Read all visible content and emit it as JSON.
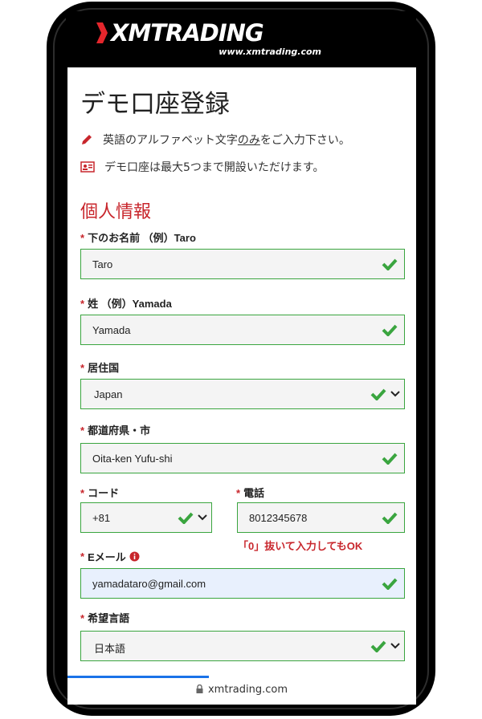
{
  "logo": {
    "brand": "XMTRADING",
    "url": "www.xmtrading.com"
  },
  "page": {
    "title": "デモ口座登録",
    "note1_prefix": "英語のアルファベット文字",
    "note1_underline": "のみ",
    "note1_suffix": "をご入力下さい。",
    "note2": "デモ口座は最大5つまで開設いただけます。"
  },
  "section": {
    "title": "個人情報"
  },
  "form": {
    "required_mark": "*",
    "first_name": {
      "label": "下のお名前 （例）Taro",
      "value": "Taro"
    },
    "last_name": {
      "label": "姓 （例）Yamada",
      "value": "Yamada"
    },
    "country": {
      "label": "居住国",
      "value": "Japan"
    },
    "city": {
      "label": "都道府県・市",
      "value": "Oita-ken Yufu-shi"
    },
    "code": {
      "label": "コード",
      "value": "+81"
    },
    "phone": {
      "label": "電話",
      "value": "8012345678",
      "hint": "「0」抜いて入力してもOK"
    },
    "email": {
      "label": "Eメール",
      "value": "yamadataro@gmail.com"
    },
    "language": {
      "label": "希望言語",
      "value": "日本語"
    }
  },
  "browser": {
    "url": "xmtrading.com"
  },
  "colors": {
    "accent": "#c8262c",
    "valid": "#3aa53f",
    "progress": "#1a73e8"
  }
}
